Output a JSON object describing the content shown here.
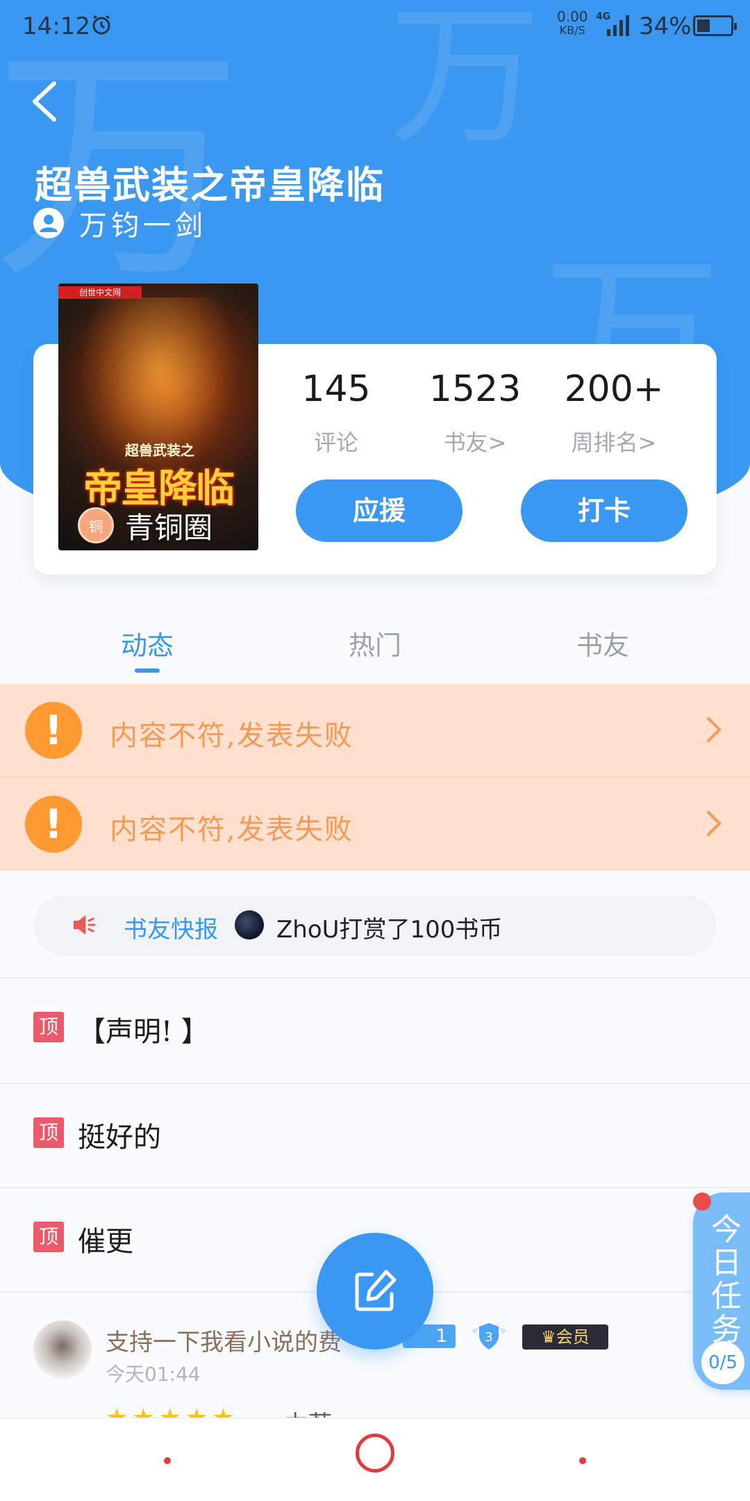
{
  "status_bar": {
    "time": "14:12",
    "net_speed_value": "0.00",
    "net_speed_unit": "KB/S",
    "network_type": "4G",
    "battery_text": "34%",
    "battery_level_fraction": 0.34
  },
  "header": {
    "book_title": "超兽武装之帝皇降临",
    "author": "万钧一剑",
    "watermark_char": "万"
  },
  "cover": {
    "publisher_logo_text": "创世中文网",
    "subtitle": "超兽武装之",
    "big_title": "帝皇降临",
    "tier_icon_text": "铜",
    "tier_label": "青铜圈"
  },
  "stats": [
    {
      "value": "145",
      "label": "评论"
    },
    {
      "value": "1523",
      "label": "书友>"
    },
    {
      "value": "200+",
      "label": "周排名>"
    }
  ],
  "actions": {
    "support_label": "应援",
    "checkin_label": "打卡"
  },
  "tabs": [
    {
      "label": "动态",
      "active": true
    },
    {
      "label": "热门",
      "active": false
    },
    {
      "label": "书友",
      "active": false
    }
  ],
  "alerts": [
    {
      "icon": "!",
      "message": "内容不符,发表失败"
    },
    {
      "icon": "!",
      "message": "内容不符,发表失败"
    }
  ],
  "news": {
    "label": "书友快报",
    "text": "ZhoU打赏了100书币"
  },
  "pinned": [
    {
      "tag": "顶",
      "text": "【声明! 】"
    },
    {
      "tag": "顶",
      "text": "挺好的"
    },
    {
      "tag": "顶",
      "text": "催更"
    }
  ],
  "post": {
    "username": "支持一下我看小说的费",
    "time": "今天01:44",
    "level": "1",
    "shield_level": "3",
    "vip_label": "会员",
    "stars": "★★★★★",
    "rating_text": "力荐"
  },
  "task": {
    "label": "今日任务",
    "progress": "0/5"
  },
  "colors": {
    "primary": "#3a98f0",
    "alert_bg": "#ffe0ce",
    "alert_text": "#f39a55",
    "pin_tag": "#ea5a6a",
    "nav_red": "#e13b3b"
  }
}
